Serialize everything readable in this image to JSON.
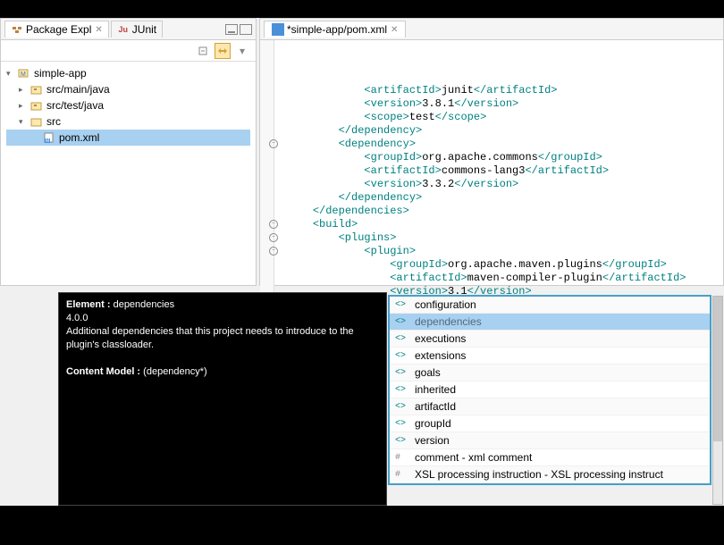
{
  "leftPanel": {
    "tabs": [
      {
        "label": "Package Expl",
        "active": true,
        "icon": "package-explorer"
      },
      {
        "label": "JUnit",
        "active": false,
        "icon": "junit"
      }
    ],
    "tree": {
      "root": {
        "label": "simple-app",
        "expanded": true
      },
      "children": [
        {
          "label": "src/main/java",
          "icon": "package-folder",
          "expanded": false
        },
        {
          "label": "src/test/java",
          "icon": "package-folder",
          "expanded": false
        },
        {
          "label": "src",
          "icon": "folder",
          "expanded": true,
          "children": [
            {
              "label": "pom.xml",
              "icon": "xml-file",
              "selected": true
            }
          ]
        }
      ]
    }
  },
  "editor": {
    "tab": {
      "label": "*simple-app/pom.xml",
      "dirty": true
    },
    "lines": [
      {
        "indent": 6,
        "content": [
          {
            "t": "tag",
            "v": "<artifactId>"
          },
          {
            "t": "txt",
            "v": "junit"
          },
          {
            "t": "tag",
            "v": "</artifactId>"
          }
        ]
      },
      {
        "indent": 6,
        "content": [
          {
            "t": "tag",
            "v": "<version>"
          },
          {
            "t": "txt",
            "v": "3.8.1"
          },
          {
            "t": "tag",
            "v": "</version>"
          }
        ]
      },
      {
        "indent": 6,
        "content": [
          {
            "t": "tag",
            "v": "<scope>"
          },
          {
            "t": "txt",
            "v": "test"
          },
          {
            "t": "tag",
            "v": "</scope>"
          }
        ]
      },
      {
        "indent": 4,
        "content": [
          {
            "t": "tag",
            "v": "</dependency>"
          }
        ]
      },
      {
        "indent": 4,
        "fold": "-",
        "content": [
          {
            "t": "tag",
            "v": "<dependency>"
          }
        ]
      },
      {
        "indent": 6,
        "content": [
          {
            "t": "tag",
            "v": "<groupId>"
          },
          {
            "t": "txt",
            "v": "org.apache.commons"
          },
          {
            "t": "tag",
            "v": "</groupId>"
          }
        ]
      },
      {
        "indent": 6,
        "content": [
          {
            "t": "tag",
            "v": "<artifactId>"
          },
          {
            "t": "txt",
            "v": "commons-lang3"
          },
          {
            "t": "tag",
            "v": "</artifactId>"
          }
        ]
      },
      {
        "indent": 6,
        "content": [
          {
            "t": "tag",
            "v": "<version>"
          },
          {
            "t": "txt",
            "v": "3.3.2"
          },
          {
            "t": "tag",
            "v": "</version>"
          }
        ]
      },
      {
        "indent": 4,
        "content": [
          {
            "t": "tag",
            "v": "</dependency>"
          }
        ]
      },
      {
        "indent": 2,
        "content": [
          {
            "t": "tag",
            "v": "</dependencies>"
          }
        ]
      },
      {
        "indent": 2,
        "fold": "-",
        "content": [
          {
            "t": "tag",
            "v": "<build>"
          }
        ]
      },
      {
        "indent": 4,
        "fold": "-",
        "content": [
          {
            "t": "tag",
            "v": "<plugins>"
          }
        ]
      },
      {
        "indent": 6,
        "fold": "-",
        "content": [
          {
            "t": "tag",
            "v": "<plugin>"
          }
        ]
      },
      {
        "indent": 8,
        "content": [
          {
            "t": "tag",
            "v": "<groupId>"
          },
          {
            "t": "txt",
            "v": "org.apache.maven.plugins"
          },
          {
            "t": "tag",
            "v": "</groupId>"
          }
        ]
      },
      {
        "indent": 8,
        "content": [
          {
            "t": "tag",
            "v": "<artifactId>"
          },
          {
            "t": "txt",
            "v": "maven-compiler-plugin"
          },
          {
            "t": "tag",
            "v": "</artifactId>"
          }
        ]
      },
      {
        "indent": 8,
        "content": [
          {
            "t": "tag",
            "v": "<version>"
          },
          {
            "t": "txt",
            "v": "3.1"
          },
          {
            "t": "tag",
            "v": "</version>"
          }
        ]
      },
      {
        "indent": 8,
        "cursor": true,
        "content": []
      }
    ]
  },
  "tooltip": {
    "elementLabel": "Element :",
    "elementName": "dependencies",
    "version": "4.0.0",
    "description": "Additional dependencies that this project needs to introduce to the plugin's classloader.",
    "modelLabel": "Content Model :",
    "modelValue": "(dependency*)"
  },
  "autocomplete": {
    "items": [
      {
        "icon": "<>",
        "label": "configuration"
      },
      {
        "icon": "<>",
        "label": "dependencies",
        "selected": true
      },
      {
        "icon": "<>",
        "label": "executions"
      },
      {
        "icon": "<>",
        "label": "extensions"
      },
      {
        "icon": "<>",
        "label": "goals"
      },
      {
        "icon": "<>",
        "label": "inherited"
      },
      {
        "icon": "<>",
        "label": "artifactId"
      },
      {
        "icon": "<>",
        "label": "groupId"
      },
      {
        "icon": "<>",
        "label": "version"
      },
      {
        "icon": "#",
        "label": "comment - xml comment"
      },
      {
        "icon": "#",
        "label": "XSL processing instruction - XSL processing instruct"
      }
    ]
  }
}
